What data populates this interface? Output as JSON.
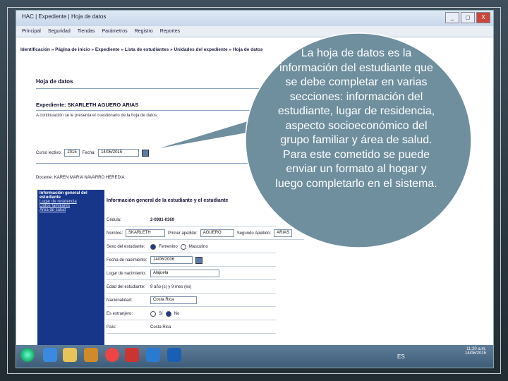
{
  "window": {
    "title": "HAC | Expediente | Hoja de datos",
    "min": "_",
    "max": "◻",
    "close": "X"
  },
  "menu": [
    "Principal",
    "Seguridad",
    "Tiendas",
    "Parámetros",
    "Registro",
    "Reportes"
  ],
  "breadcrumb": "Identificación » Página de inicio » Expediente » Lista de estudiantes » Unidades del expediente » Hoja de datos",
  "page_title": "Hoja de datos",
  "expediente": "Expediente:  SKARLETH AGUERO ARIAS",
  "intro": "A continuación se le presenta el cuestionario de la hoja de datos:",
  "course": {
    "label": "Curso lectivo:",
    "value": "2015",
    "date_label": "Fecha:",
    "date_value": "14/06/2015"
  },
  "teacher": {
    "label": "Docente:",
    "value": "KAREN MARIA NAVARRO HEREDIA"
  },
  "side_panel": {
    "title": "Información general del estudiante",
    "items": [
      "Lugar de residencia",
      "Datos familiares",
      "Área de salud"
    ]
  },
  "section_title": "Información general de la estudiante y el estudiante",
  "form": {
    "cedula": {
      "label": "Cédula:",
      "value": "2-0981-0369"
    },
    "nombre": {
      "label": "Nombre:",
      "value": "SKARLETH"
    },
    "primer_apellido": {
      "label": "Primer apellido:",
      "value": "AGUERO"
    },
    "segundo_apellido": {
      "label": "Segundo Apellido:",
      "value": "ARIAS"
    },
    "sexo": {
      "label": "Sexo del estudiante:",
      "opt1": "Femenino",
      "opt2": "Masculino"
    },
    "fecha_nac": {
      "label": "Fecha de nacimiento:",
      "value": "14/06/2006"
    },
    "lugar_nac": {
      "label": "Lugar de nacimiento:",
      "value": "Alajuela"
    },
    "edad": {
      "label": "Edad del estudiante:",
      "value": "9 año (s) y 9 mes (es)"
    },
    "nacionalidad": {
      "label": "Nacionalidad:",
      "value": "Costa Rica"
    },
    "extranjero": {
      "label": "Es extranjero:",
      "opt1": "Sí",
      "opt2": "No"
    },
    "pais": {
      "label": "País:",
      "value": "Costa Rica"
    }
  },
  "taskbar": {
    "lang": "ES",
    "time": "11:20 a.m.",
    "date": "14/06/2015"
  },
  "callout": "La hoja de datos es la información del estudiante que se debe completar en varias secciones: información del estudiante, lugar de residencia, aspecto socioeconómico del grupo familiar y área de salud. Para este cometido se puede enviar un formato al hogar y luego completarlo en el sistema.",
  "colors": {
    "callout_fill": "#6f8f9f",
    "panel_blue": "#17368a",
    "taskbar": "#4b6a86"
  }
}
